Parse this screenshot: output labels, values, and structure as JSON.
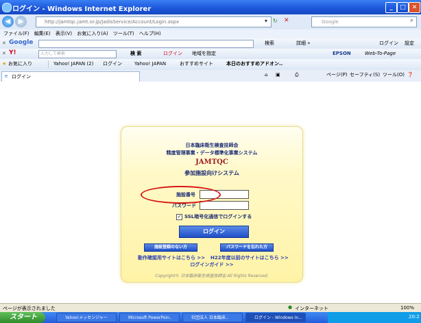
{
  "window": {
    "title": "ログイン - Windows Internet Explorer",
    "url": "http://jamtqc.jamt.or.jp/JadisService/Account/Login.aspx",
    "search_engine": "Google"
  },
  "menu": [
    "ファイル(F)",
    "編集(E)",
    "表示(V)",
    "お気に入り(A)",
    "ツール(T)",
    "ヘルプ(H)"
  ],
  "google_toolbar": {
    "logo": "Google",
    "search_label": "検索",
    "more_label": "詳細 »",
    "login": "ログイン",
    "settings": "設定"
  },
  "yahoo_toolbar": {
    "logo": "Y!",
    "placeholder": "入力して検索",
    "search_btn": "検 索",
    "login": "ログイン",
    "region": "地域を指定",
    "brand": "EPSON",
    "webtopage": "Web-To-Page"
  },
  "favorites_bar": {
    "label": "お気に入り",
    "items": [
      "Yahoo! JAPAN (2)",
      "ログイン",
      "Yahoo! JAPAN",
      "おすすめサイト",
      "本日のおすすめアドオン.."
    ]
  },
  "tab": {
    "label": "ログイン",
    "commands": [
      "ページ(P)",
      "セーフティ(S)",
      "ツール(O)"
    ]
  },
  "login": {
    "org": "日本臨床衛生検査技師会",
    "project": "精度管理事業・データ標準化事業システム",
    "system_code": "JAMTQC",
    "system_name": "参加施設向けシステム",
    "facility_label": "施設番号",
    "password_label": "パスワード",
    "ssl_label": "SSL暗号化通信でログインする",
    "login_button": "ログイン",
    "no_facility_button": "施設登録のない方",
    "forgot_password_button": "パスワードを忘れた方",
    "link_legacy": "動作確認用サイトはこちら >>",
    "link_h22": "H22年度以前のサイトはこちら >>",
    "link_guide": "ログインガイド >>",
    "copyright": "Copyright© 日本臨床衛生検査技師会   All Rights Reserved."
  },
  "status": {
    "text": "ページが表示されました",
    "zone": "インターネット",
    "zoom": "100%"
  },
  "taskbar": {
    "start": "スタート",
    "tasks": [
      "Yahoo!メッセンジャー",
      "Microsoft PowerPoin..",
      "社団法人 日本臨床..",
      "ログイン - Windows In..."
    ],
    "clock": "20:2"
  }
}
